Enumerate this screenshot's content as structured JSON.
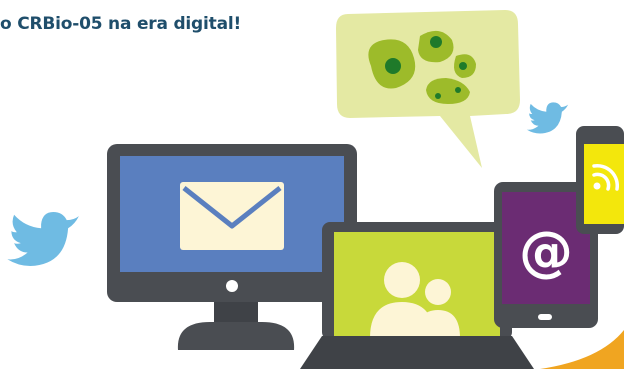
{
  "banner": {
    "headline": "o CRBio-05 na era digital!",
    "email_symbol": "@"
  },
  "palette": {
    "headline_text": "#1f4e6b",
    "twitter_bird": "#6fbbe3",
    "monitor_screen": "#5a7fbf",
    "laptop_screen": "#c8d93a",
    "tablet_screen": "#6b2c73",
    "phone_screen": "#f3e70c",
    "speech_bubble": "#e4e9a3",
    "cell_green": "#9dbb2a",
    "device_body": "#4a4d52",
    "accent_orange": "#f0a521"
  },
  "icons": [
    "twitter-bird-icon",
    "envelope-icon",
    "people-icon",
    "at-sign-icon",
    "rss-icon",
    "cell-cluster-icon"
  ]
}
